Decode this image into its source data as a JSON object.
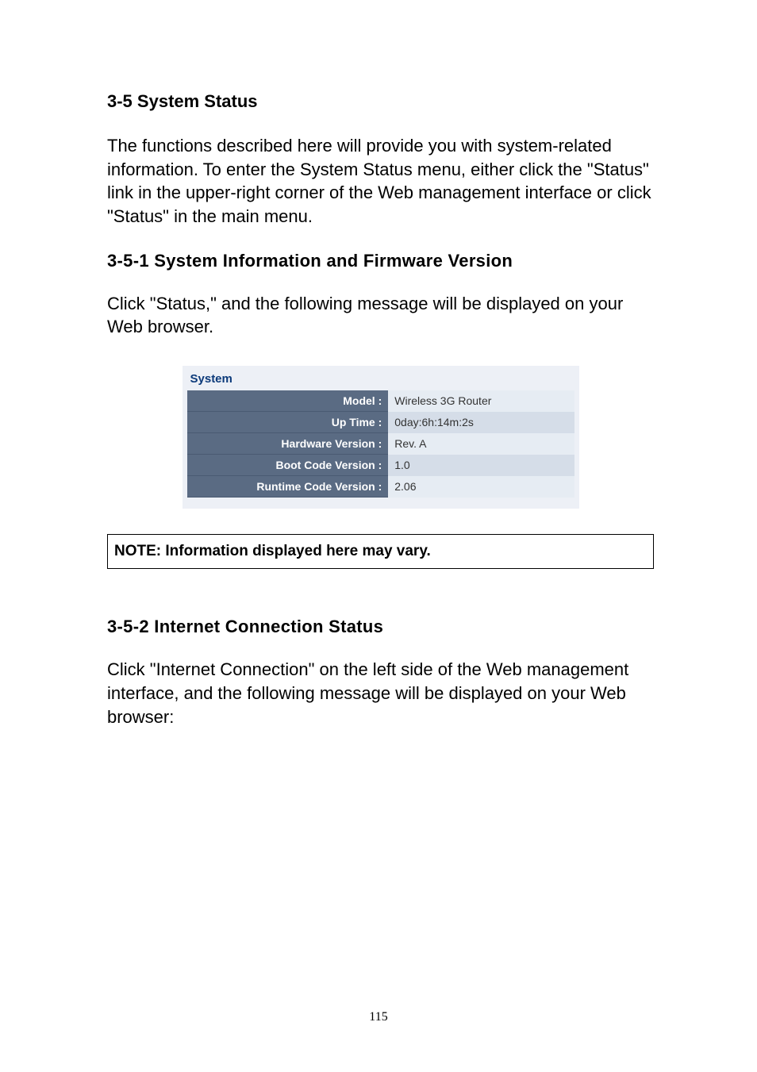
{
  "section": {
    "num": "3-5",
    "title": "System Status"
  },
  "para1": "The functions described here will provide you with system-related information. To enter the System Status menu, either click the \"Status\" link in the upper-right corner of the Web management interface or click \"Status\" in the main menu.",
  "sub1": {
    "num": "3-5-1",
    "title": "System Information and Firmware Version"
  },
  "para2": "Click \"Status,\" and the following message will be displayed on your Web browser.",
  "system_table": {
    "heading": "System",
    "rows": [
      {
        "label": "Model :",
        "value": "Wireless 3G Router"
      },
      {
        "label": "Up Time :",
        "value": "0day:6h:14m:2s"
      },
      {
        "label": "Hardware Version :",
        "value": "Rev. A"
      },
      {
        "label": "Boot Code Version :",
        "value": "1.0"
      },
      {
        "label": "Runtime Code Version :",
        "value": "2.06"
      }
    ]
  },
  "note": "NOTE: Information displayed here may vary.",
  "sub2": {
    "num": "3-5-2",
    "title": "Internet Connection Status"
  },
  "para3": "Click \"Internet Connection\" on the left side of the Web management interface, and the following message will be displayed on your Web browser:",
  "page_number": "115"
}
